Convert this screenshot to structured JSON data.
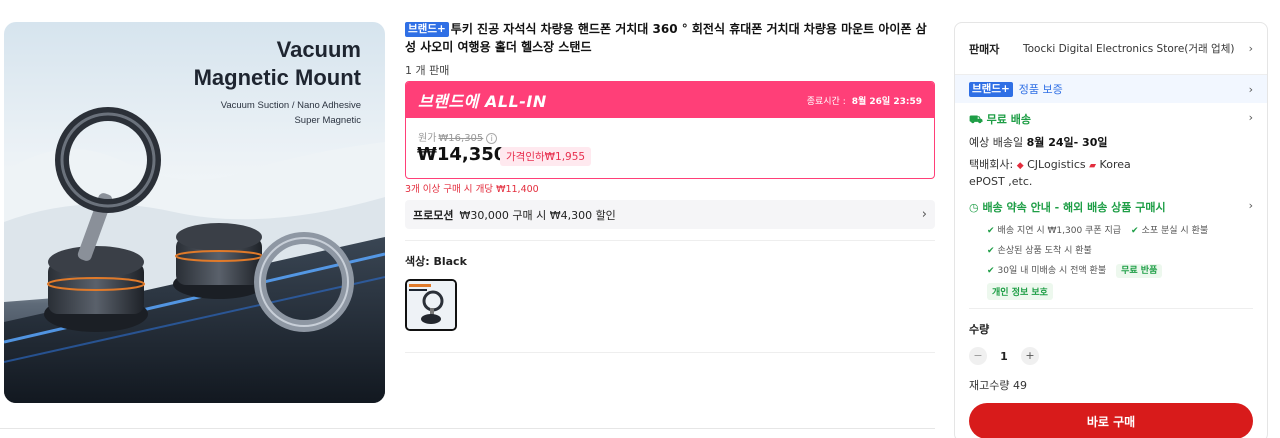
{
  "product_image": {
    "title_line1": "Vacuum",
    "title_line2": "Magnetic Mount",
    "subtitle_line1": "Vacuum Suction / Nano Adhesive",
    "subtitle_line2": "Super Magnetic"
  },
  "product": {
    "brand_badge": "브랜드+",
    "title": "투키 진공 자석식 차량용 핸드폰 거치대 360 ° 회전식 휴대폰 거치대 차량용 마운트 아이폰 삼성 사오미 여행용 홀더 헬스장 스탠드",
    "sold": "1 개 판매"
  },
  "deal": {
    "banner": "브랜드에 ALL-IN",
    "deadline_label": "종료시간 :",
    "deadline_value": "8월 26일 23:59",
    "original_label": "원가",
    "original_price": "₩16,305",
    "price": "₩14,350",
    "discount": "가격인하₩1,955",
    "bulk_note": "3개 이상 구매 시 개당 ₩11,400"
  },
  "promo": {
    "tag": "프로모션",
    "text": "₩30,000 구매 시 ₩4,300 할인"
  },
  "color": {
    "label": "색상: Black"
  },
  "seller": {
    "label": "판매자",
    "name": "Toocki Digital Electronics Store(거래 업체)"
  },
  "brand_row": {
    "badge": "브랜드+",
    "text": "정품 보증"
  },
  "shipping": {
    "title": "무료 배송",
    "eta_label": "예상 배송일",
    "eta_value": "8월 24일- 30일",
    "carrier_label": "택배회사:",
    "carrier_1": "CJLogistics",
    "carrier_2": "Korea",
    "carrier_3": "ePOST ,etc."
  },
  "promise": {
    "title": "배송 약속 안내 - 해외 배송 상품 구매시",
    "items": [
      "배송 지연 시 ₩1,300 쿠폰 지급",
      "소포 분실 시 환불",
      "손상된 상품 도착 시 환불",
      "30일 내 미배송 시 전액 환불"
    ],
    "badge_return": "무료 반품",
    "badge_privacy": "개인 정보 보호"
  },
  "quantity": {
    "label": "수량",
    "minus": "−",
    "value": "1",
    "plus": "+",
    "stock": "재고수량 49"
  },
  "buy_button": "바로 구매",
  "colors": {
    "accent_pink": "#ff3f78",
    "buy_red": "#d81b1b",
    "brand_blue": "#2f6fe5",
    "green": "#1e9e46"
  }
}
